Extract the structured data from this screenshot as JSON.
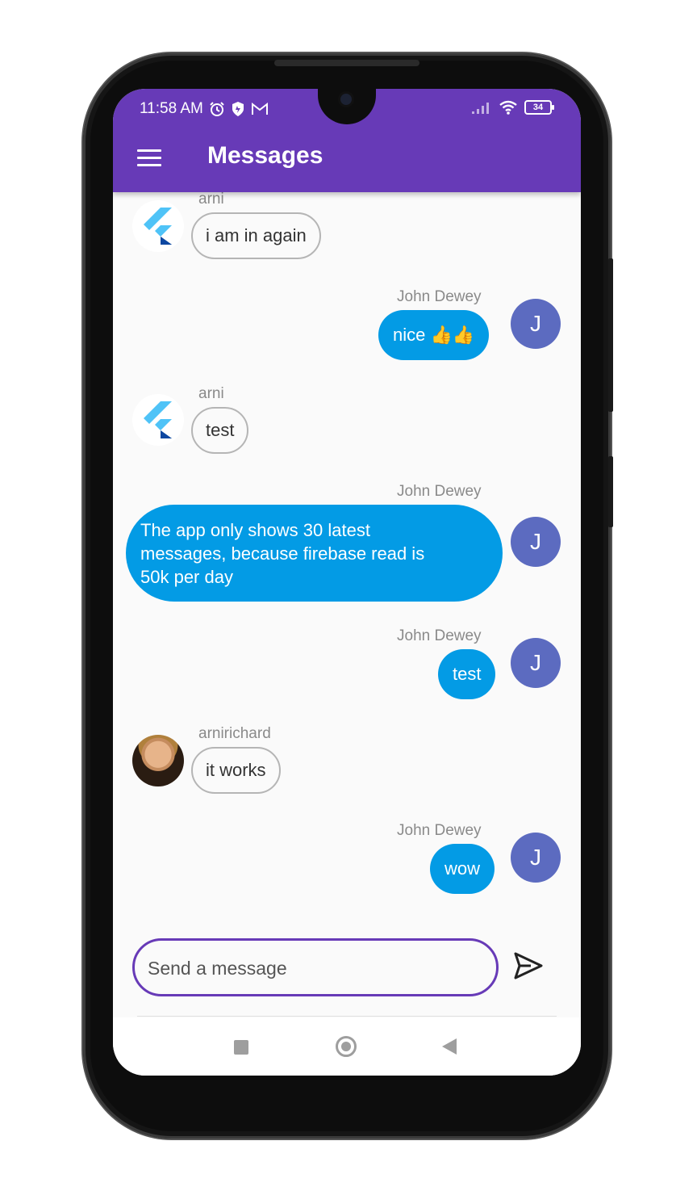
{
  "status_bar": {
    "time": "11:58 AM",
    "battery": "34",
    "icons": [
      "alarm-icon",
      "shield-icon",
      "gmail-icon",
      "signal-icon",
      "wifi-icon",
      "battery-icon"
    ]
  },
  "app_bar": {
    "title": "Messages",
    "menu_icon": "hamburger-menu-icon",
    "color": "#673ab7"
  },
  "messages": [
    {
      "sender": "arni",
      "text": "i am in again",
      "outgoing": false,
      "avatar": "flutter-logo"
    },
    {
      "sender": "John Dewey",
      "text": "nice 👍👍",
      "outgoing": true,
      "avatar_letter": "J"
    },
    {
      "sender": "arni",
      "text": "test",
      "outgoing": false,
      "avatar": "flutter-logo"
    },
    {
      "sender": "John Dewey",
      "text_lines": [
        "The app only shows 30 latest",
        "messages, because firebase read is",
        "50k per day"
      ],
      "outgoing": true,
      "avatar_letter": "J"
    },
    {
      "sender": "John Dewey",
      "text": "test",
      "outgoing": true,
      "avatar_letter": "J"
    },
    {
      "sender": "arnirichard",
      "text": "it works",
      "outgoing": false,
      "avatar": "photo"
    },
    {
      "sender": "John Dewey",
      "text": "wow",
      "outgoing": true,
      "avatar_letter": "J"
    }
  ],
  "composer": {
    "placeholder": "Send a message",
    "value": "",
    "send_icon": "send-icon"
  },
  "colors": {
    "outgoing_bubble": "#039be5",
    "avatar_bg": "#5c6bc0",
    "accent": "#673ab7"
  }
}
